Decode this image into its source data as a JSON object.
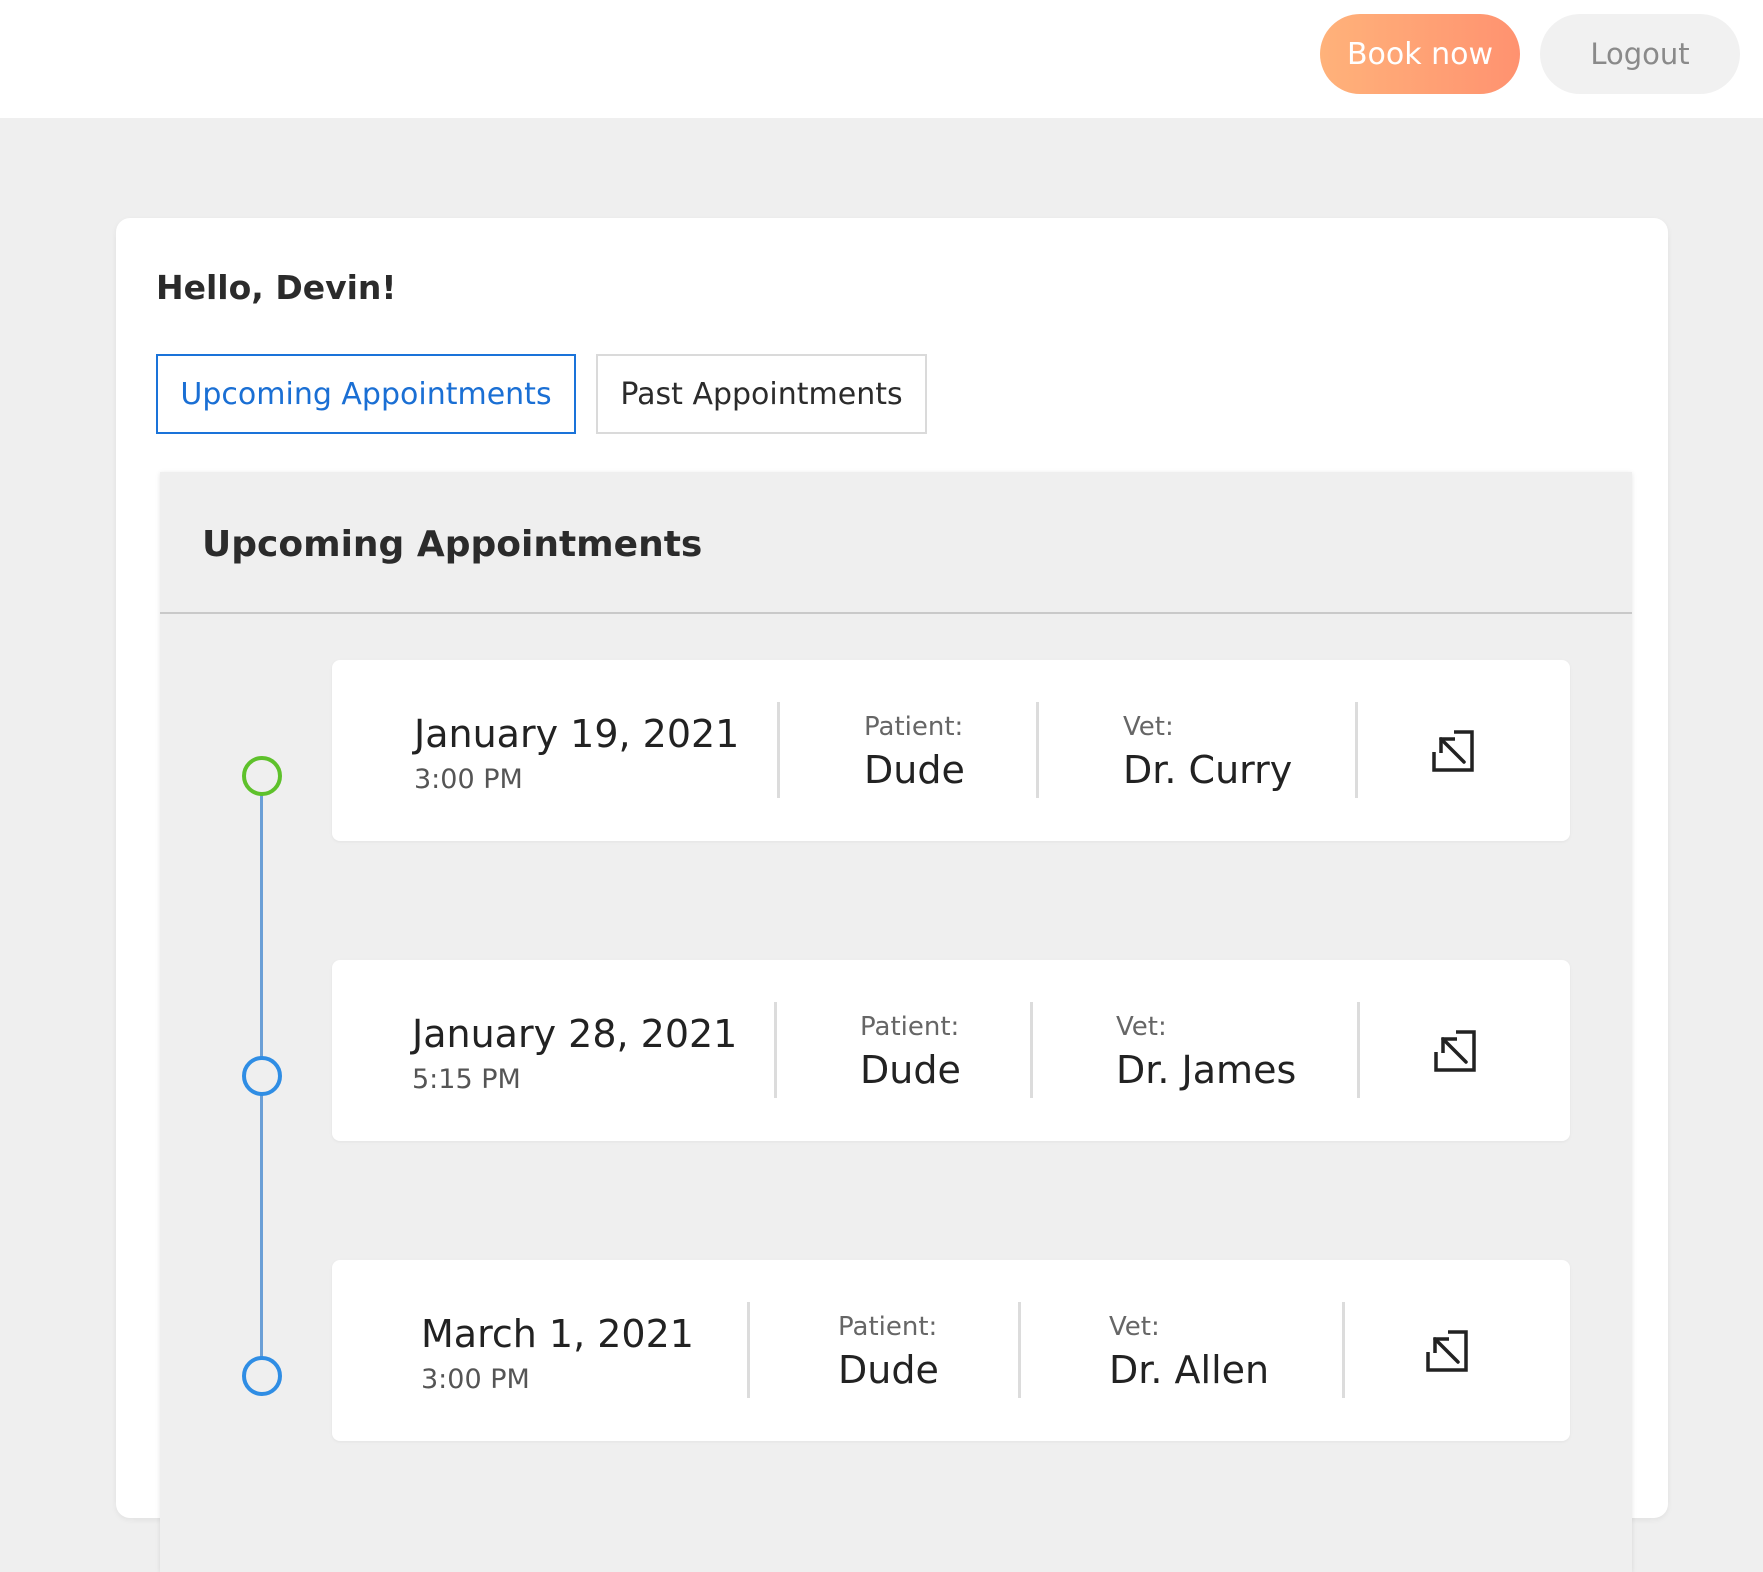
{
  "header": {
    "book_label": "Book now",
    "logout_label": "Logout"
  },
  "greeting": "Hello, Devin!",
  "tabs": [
    {
      "label": "Upcoming Appointments",
      "active": true
    },
    {
      "label": "Past Appointments",
      "active": false
    }
  ],
  "panel": {
    "title": "Upcoming Appointments"
  },
  "appointments": [
    {
      "date": "January 19, 2021",
      "time": "3:00 PM",
      "patient_label": "Patient:",
      "patient": "Dude",
      "vet_label": "Vet:",
      "vet": "Dr. Curry",
      "status": "current"
    },
    {
      "date": "January 28, 2021",
      "time": "5:15 PM",
      "patient_label": "Patient:",
      "patient": "Dude",
      "vet_label": "Vet:",
      "vet": "Dr. James",
      "status": "upcoming"
    },
    {
      "date": "March 1, 2021",
      "time": "3:00 PM",
      "patient_label": "Patient:",
      "patient": "Dude",
      "vet_label": "Vet:",
      "vet": "Dr. Allen",
      "status": "upcoming"
    }
  ],
  "icons": {
    "open": "open-details-icon"
  },
  "colors": {
    "accent": "#1a6fd4",
    "book_gradient_start": "#ffb27a",
    "book_gradient_end": "#ff9270",
    "timeline_current": "#5ec12b",
    "timeline_upcoming": "#2f8de4",
    "timeline_line": "#6b9fd6"
  }
}
